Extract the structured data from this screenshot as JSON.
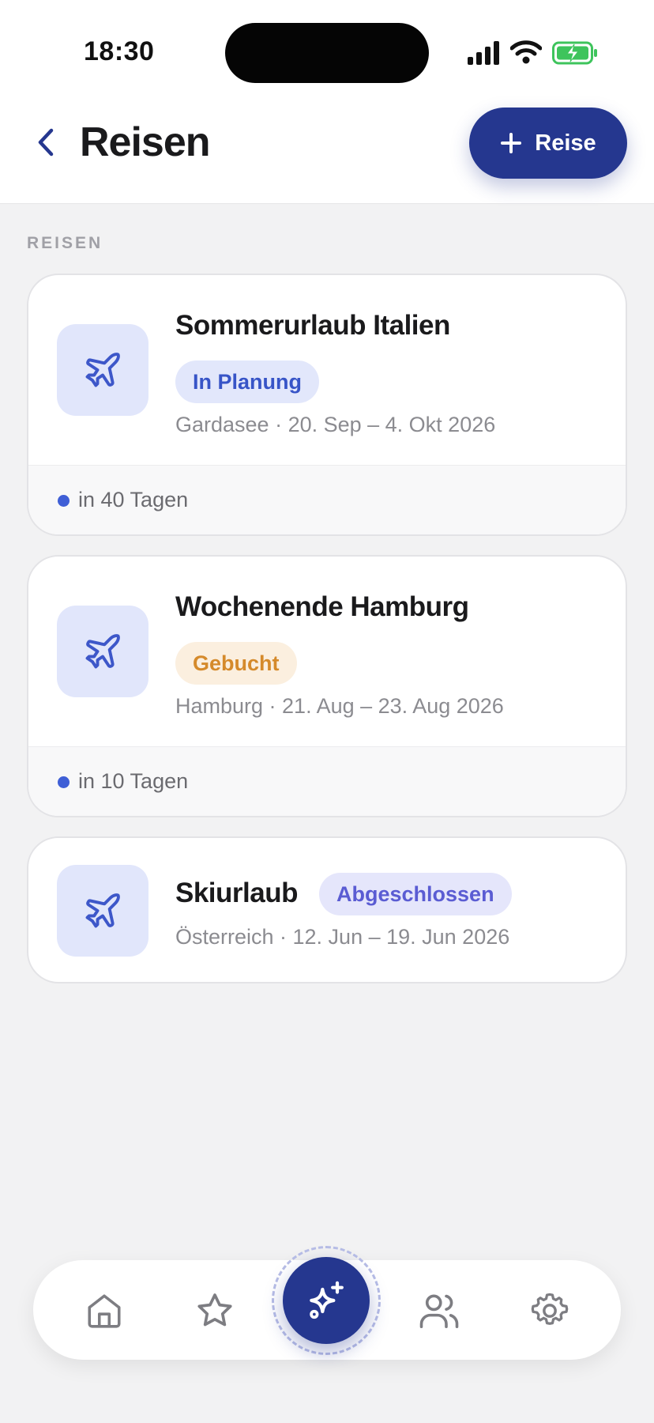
{
  "status_bar": {
    "time": "18:30",
    "icons": [
      "cellular-signal-icon",
      "wifi-icon",
      "battery-charging-icon"
    ],
    "battery_color": "#3ec45c"
  },
  "header": {
    "back_icon": "chevron-left-icon",
    "title": "Reisen",
    "add_button_label": "Reise",
    "add_button_icon": "plus-icon"
  },
  "section": {
    "label": "REISEN"
  },
  "trips": [
    {
      "title": "Sommerurlaub Italien",
      "status": "In Planung",
      "location_dates": "Gardasee · 20. Sep – 4. Okt 2026",
      "countdown": "in 40 Tagen",
      "icon": "airplane-icon"
    },
    {
      "title": "Wochenende Hamburg",
      "status": "Gebucht",
      "location_dates": "Hamburg · 21. Aug – 23. Aug 2026",
      "countdown": "in 10 Tagen",
      "icon": "airplane-icon"
    },
    {
      "title": "Skiurlaub",
      "status": "Abgeschlossen",
      "location_dates": "Österreich · 12. Jun – 19. Jun 2026",
      "icon": "airplane-icon"
    }
  ],
  "tabbar": {
    "items": [
      "home-icon",
      "star-icon",
      "sparkles-icon",
      "users-icon",
      "settings-icon"
    ],
    "active": "sparkles-icon"
  },
  "colors": {
    "accent": "#25378f",
    "badge_planung": "#3754c7",
    "badge_gebucht": "#d58a2b",
    "badge_abgeschlossen": "#5a5cd3",
    "countdown_dot": "#3f5fd6"
  }
}
